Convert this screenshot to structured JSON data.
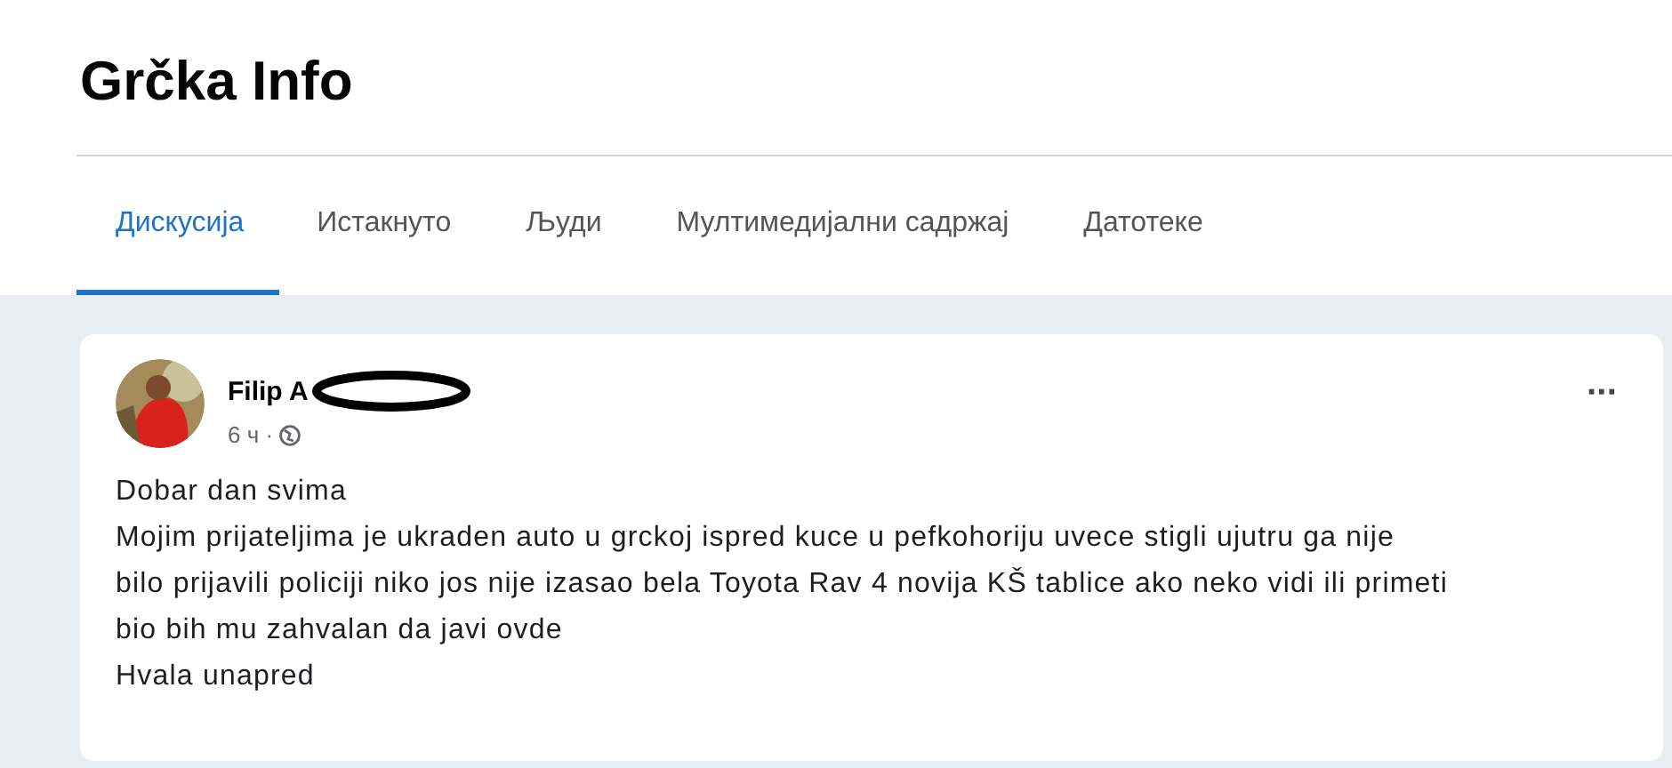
{
  "group": {
    "title": "Grčka Info"
  },
  "tabs": [
    {
      "label": "Дискусија",
      "selected": true
    },
    {
      "label": "Истакнуто",
      "selected": false
    },
    {
      "label": "Људи",
      "selected": false
    },
    {
      "label": "Мултимедијални садржај",
      "selected": false
    },
    {
      "label": "Датотеке",
      "selected": false
    }
  ],
  "post": {
    "author": "Filip A",
    "time": "6 ч ·",
    "menu": "···",
    "paragraphs": [
      "Dobar dan svima",
      "Mojim prijateljima je ukraden auto u grckoj ispred kuce u pefkohoriju uvece stigli ujutru ga nije bilo prijavili policiji niko jos nije izasao bela Toyota Rav 4 novija KŠ tablice ako neko vidi ili primeti bio bih mu zahvalan da javi ovde",
      "Hvala unapred"
    ]
  }
}
